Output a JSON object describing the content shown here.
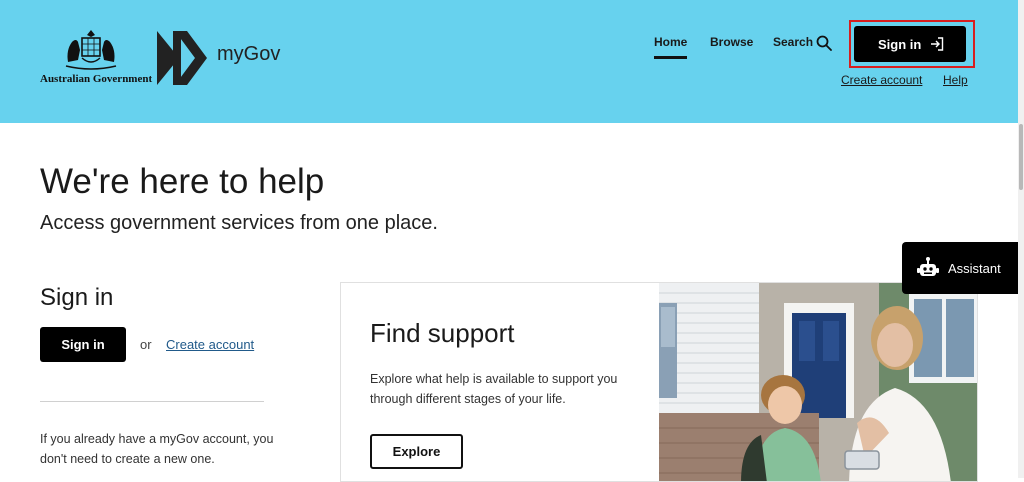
{
  "header": {
    "gov_name": "Australian Government",
    "brand": "myGov",
    "nav": {
      "home": "Home",
      "browse": "Browse",
      "search": "Search"
    },
    "signin_label": "Sign in",
    "create_account": "Create account",
    "help": "Help",
    "background": "#67d2ee"
  },
  "hero": {
    "title": "We're here to help",
    "subtitle": "Access government services from one place."
  },
  "signin_section": {
    "heading": "Sign in",
    "button": "Sign in",
    "or": "or",
    "create_link": "Create account",
    "note": "If you already have a myGov account, you don't need to create a new one."
  },
  "support_card": {
    "title": "Find support",
    "description": "Explore what help is available to support you through different stages of your life.",
    "button": "Explore"
  },
  "assistant": {
    "label": "Assistant"
  },
  "colors": {
    "accent": "#67d2ee",
    "highlight": "#d81e1e",
    "link": "#215a8a"
  }
}
